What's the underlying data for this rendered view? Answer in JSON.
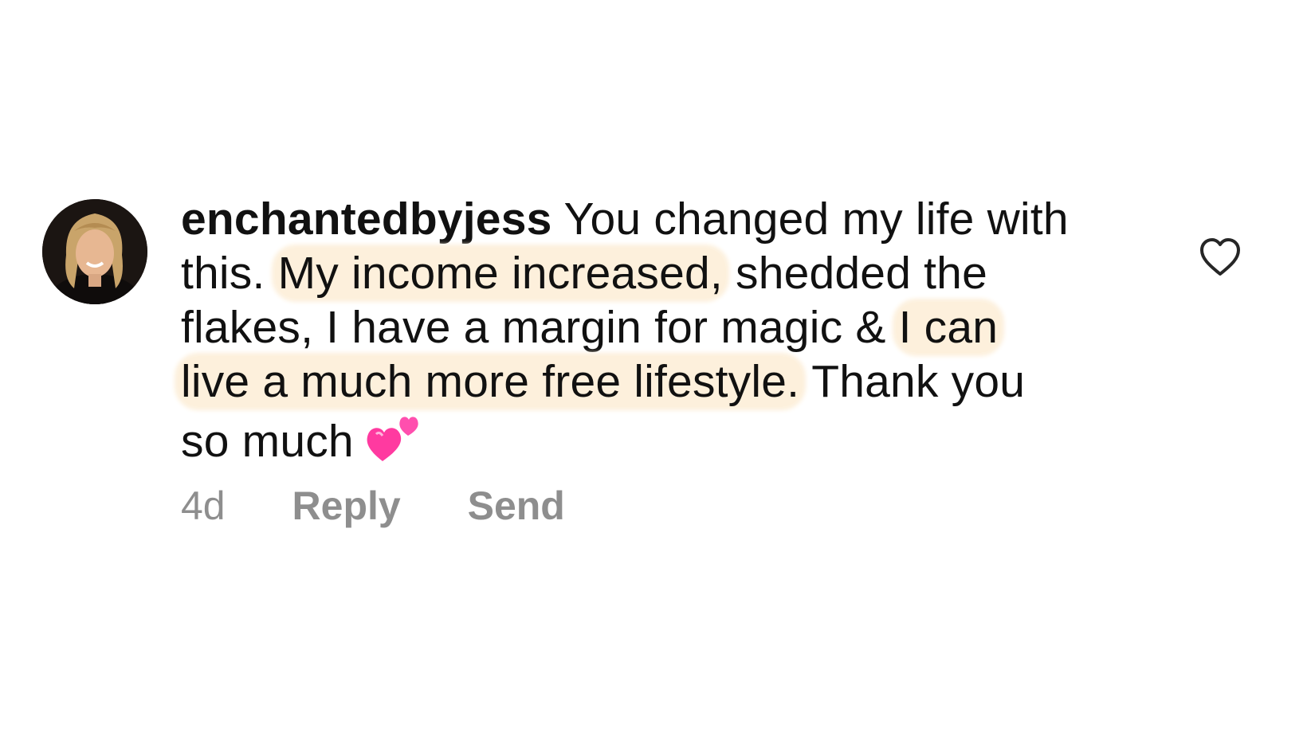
{
  "comment": {
    "username": "enchantedbyjess",
    "lines": [
      {
        "pre": "You changed my life with",
        "hl": "",
        "post": ""
      },
      {
        "pre": "this. ",
        "hl": "My income increased,",
        "post": " shedded the"
      },
      {
        "pre": "flakes, I have a margin for magic & ",
        "hl": "I can",
        "post": ""
      },
      {
        "pre": "",
        "hl": "live a much more free lifestyle.",
        "post": " Thank you"
      },
      {
        "pre": "so much",
        "hl": "",
        "post": ""
      }
    ],
    "emoji": "two-hearts-icon",
    "timestamp": "4d",
    "reply_label": "Reply",
    "send_label": "Send"
  },
  "icons": {
    "like": "heart-outline-icon",
    "avatar": "profile-photo"
  },
  "colors": {
    "highlight": "#fdf0dc",
    "meta_text": "#8e8e8e",
    "body_text": "#111111",
    "emoji_pink": "#ff3aa0"
  }
}
